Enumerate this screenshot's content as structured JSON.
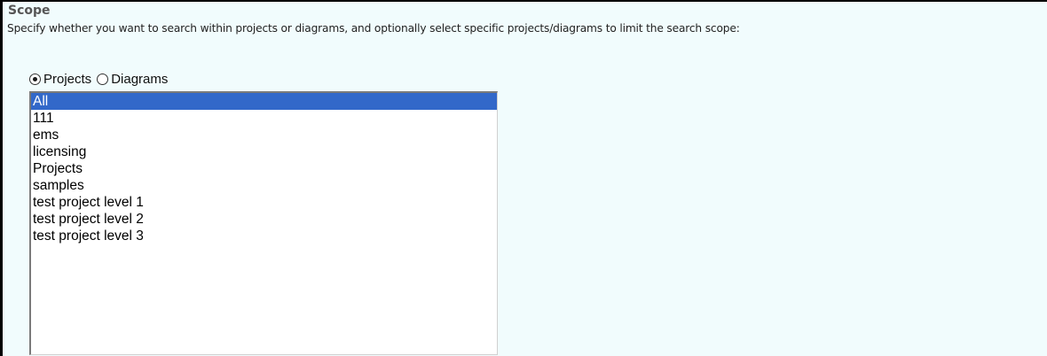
{
  "scope": {
    "title": "Scope",
    "description": "Specify whether you want to search within projects or diagrams, and optionally select specific projects/diagrams to limit the search scope:",
    "radio": {
      "selected": "Projects",
      "options": [
        {
          "label": "Projects",
          "checked": true
        },
        {
          "label": "Diagrams",
          "checked": false
        }
      ]
    },
    "list": {
      "selected_item": "All",
      "items": [
        {
          "label": "All"
        },
        {
          "label": "111"
        },
        {
          "label": "ems"
        },
        {
          "label": "licensing"
        },
        {
          "label": "Projects"
        },
        {
          "label": "samples"
        },
        {
          "label": "test project level 1"
        },
        {
          "label": "test project level 2"
        },
        {
          "label": "test project level 3"
        }
      ]
    }
  },
  "colors": {
    "panel_background": "#f1fcfd",
    "selection_background": "#3268c9",
    "title_text": "#555555"
  }
}
